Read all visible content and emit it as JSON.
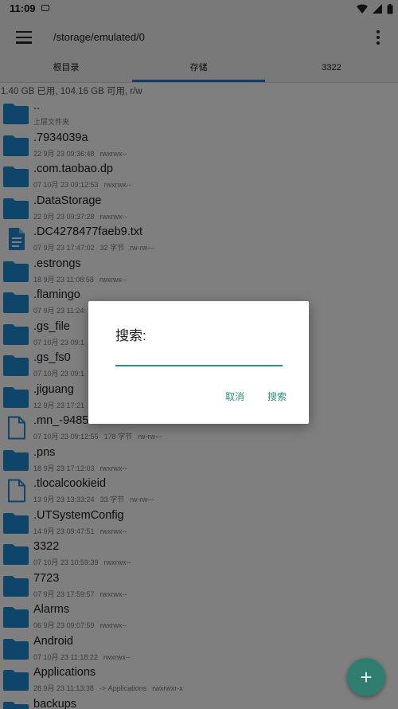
{
  "status_bar": {
    "time": "11:09"
  },
  "app_bar": {
    "path": "/storage/emulated/0"
  },
  "tabs": [
    {
      "label": "根目录",
      "active": false
    },
    {
      "label": "存储",
      "active": true
    },
    {
      "label": "3322",
      "active": false
    }
  ],
  "storage_info": "1.40 GB 已用, 104.16 GB 可用, r/w",
  "files": [
    {
      "name": "..",
      "date": "上层文件夹",
      "size": "",
      "perm": "",
      "type": "folder"
    },
    {
      "name": ".7934039a",
      "date": "22 9月 23 09:36:48",
      "size": "",
      "perm": "rwxrwx--",
      "type": "folder"
    },
    {
      "name": ".com.taobao.dp",
      "date": "07 10月 23 09:12:53",
      "size": "",
      "perm": "rwxrwx--",
      "type": "folder"
    },
    {
      "name": ".DataStorage",
      "date": "22 9月 23 09:37:28",
      "size": "",
      "perm": "rwxrwx--",
      "type": "folder"
    },
    {
      "name": ".DC4278477faeb9.txt",
      "date": "07 9月 23 17:47:02",
      "size": "32 字节",
      "perm": "rw-rw---",
      "type": "text"
    },
    {
      "name": ".estrongs",
      "date": "18 9月 23 11:08:58",
      "size": "",
      "perm": "rwxrwx--",
      "type": "folder"
    },
    {
      "name": ".flamingo",
      "date": "07 9月 23 11:24:",
      "size": "",
      "perm": "",
      "type": "folder"
    },
    {
      "name": ".gs_file",
      "date": "07 10月 23 09:1",
      "size": "",
      "perm": "",
      "type": "folder"
    },
    {
      "name": ".gs_fs0",
      "date": "07 10月 23 09:1",
      "size": "",
      "perm": "",
      "type": "folder"
    },
    {
      "name": ".jiguang",
      "date": "12 9月 23 17:21",
      "size": "",
      "perm": "",
      "type": "folder"
    },
    {
      "name": ".mn_-9485",
      "date": "07 10月 23 09:12:55",
      "size": "178 字节",
      "perm": "rw-rw---",
      "type": "file"
    },
    {
      "name": ".pns",
      "date": "18 9月 23 17:12:03",
      "size": "",
      "perm": "rwxrwx--",
      "type": "folder"
    },
    {
      "name": ".tlocalcookieid",
      "date": "13 9月 23 13:33:24",
      "size": "33 字节",
      "perm": "rw-rw---",
      "type": "file"
    },
    {
      "name": ".UTSystemConfig",
      "date": "14 9月 23 09:47:51",
      "size": "",
      "perm": "rwxrwx--",
      "type": "folder"
    },
    {
      "name": "3322",
      "date": "07 10月 23 10:59:39",
      "size": "",
      "perm": "rwxrwx--",
      "type": "folder"
    },
    {
      "name": "7723",
      "date": "07 9月 23 17:59:57",
      "size": "",
      "perm": "rwxrwx--",
      "type": "folder"
    },
    {
      "name": "Alarms",
      "date": "06 9月 23 09:07:59",
      "size": "",
      "perm": "rwxrwx--",
      "type": "folder"
    },
    {
      "name": "Android",
      "date": "07 10月 23 11:18:22",
      "size": "",
      "perm": "rwxrwx--",
      "type": "folder"
    },
    {
      "name": "Applications",
      "date": "28 9月 23 11:13:38",
      "size": "-> Applications",
      "perm": "rwxrwxr-x",
      "type": "folder"
    },
    {
      "name": "backups",
      "date": "",
      "size": "",
      "perm": "",
      "type": "folder"
    }
  ],
  "dialog": {
    "title": "搜索:",
    "input_value": "",
    "cancel_label": "取消",
    "search_label": "搜索"
  },
  "fab": {
    "label": "+"
  },
  "colors": {
    "accent": "#2a8f80",
    "tab_indicator": "#2d74c8",
    "folder": "#1f8bd3"
  }
}
